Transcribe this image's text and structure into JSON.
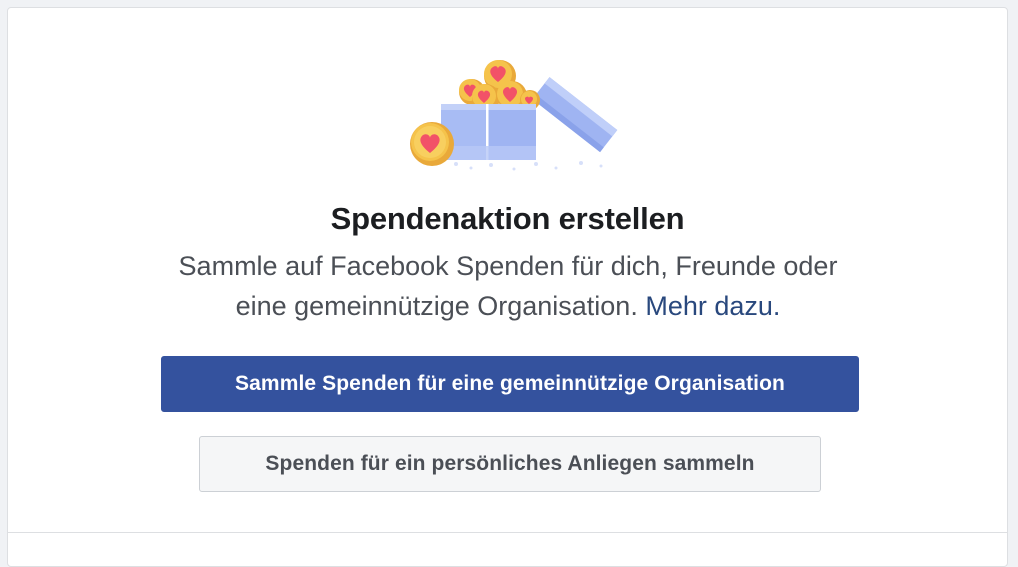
{
  "fundraiser": {
    "title": "Spendenaktion erstellen",
    "description_line1": "Sammle auf Facebook Spenden für dich, Freunde oder",
    "description_line2": "eine gemeinnützige Organisation.",
    "more_link": "Mehr dazu.",
    "primary_button": "Sammle Spenden für eine gemeinnützige Organisation",
    "secondary_button": "Spenden für ein persönliches Anliegen sammeln",
    "illustration_icon": "gift-box-with-heart-coins-icon"
  },
  "colors": {
    "primary_button_bg": "#34529e",
    "link": "#29487d",
    "title_text": "#1c1e21",
    "body_text": "#4b4f56",
    "box_blue": "#9fb4f2",
    "coin_gold": "#f5c34b",
    "heart_red": "#f25268"
  }
}
